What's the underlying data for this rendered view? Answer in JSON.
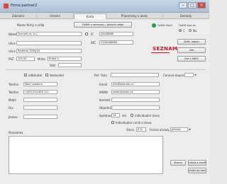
{
  "window": {
    "title": "Firma partner2"
  },
  "tabs": [
    {
      "label": "Základní"
    },
    {
      "label": "Ostatní"
    },
    {
      "label": "Karta"
    },
    {
      "label": "Připomínky a úkoly"
    },
    {
      "label": "Doklady"
    }
  ],
  "header": {
    "name_label": "Název firmy a sídla",
    "lookup_button": "Ověřit v seznamu / převzít údaje",
    "verified_label": "Ověřit Stará",
    "verify_label": "Ověřit stav se",
    "radio_c": "C",
    "radio_nu": "Nu"
  },
  "address": {
    "nazev_label": "Název",
    "nazev_value": "Seznam.cz, a.s.",
    "ulice_label": "Ulice",
    "ulice_value": "Radlická 3294/10",
    "psc_label": "PSČ",
    "psc_value": "150 00",
    "misto_label": "Místo",
    "misto_value": "Praha 5",
    "stat_label": "Stát",
    "ic_label": "IČ",
    "ic_value": "26168685",
    "dic_label": "DIČ",
    "dic_value": "CZ26168685"
  },
  "side_buttons": {
    "first": "Zpět, registr",
    "second": "Info",
    "third": "Dle z ARES"
  },
  "options": {
    "odberatel": "odběratel",
    "dodavatel": "dodavatel",
    "ref_label": "Ref. číslo",
    "cenova_label": "Cenová skupina"
  },
  "contact": {
    "telefon_label": "Telefon",
    "telefon_value": "Není uvedeno",
    "telefon2_label": "Telefon",
    "telefon2_value": "+420 234 694 111",
    "mobil_label": "Mobil",
    "fax_label": "Fax",
    "email_label": "Email",
    "email_value": "info@seznam.cz",
    "www_label": "WWW",
    "www_value": "www.seznam.cz",
    "kontakt_label": "Kontakt",
    "jmeno_label": "Jméno",
    "objednavka_label": "Objednávka",
    "splatnost_label": "Splatnost",
    "splatnost_value": "14",
    "splatnost_unit": "dní",
    "individual_label": "individuální sleva",
    "checkbox2_label": "Individuální ceník a sleva",
    "sleva_label": "Sleva",
    "sleva_value": "0 %",
    "forma_label": "Forma úhrady",
    "forma_value": "převod"
  },
  "notes": {
    "label": "Poznámka"
  },
  "buttons": {
    "storno": "Storno",
    "ulozit": "Uložit a zavřít",
    "vlozit": "Vložit do fakt."
  }
}
